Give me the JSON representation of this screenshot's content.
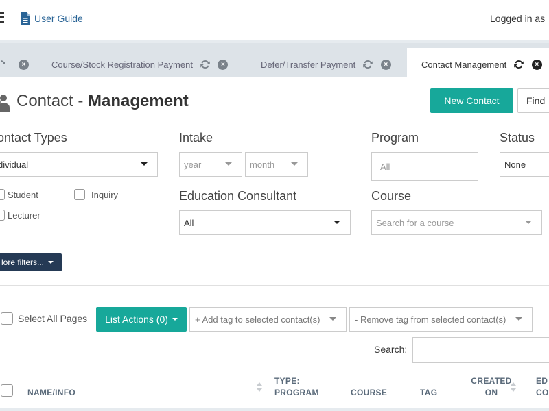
{
  "topbar": {
    "guide_label": "User Guide",
    "logged_in_text": "Logged in as"
  },
  "tabs": [
    {
      "label": "Course/Stock Registration Payment",
      "active": false
    },
    {
      "label": "Defer/Transfer Payment",
      "active": false
    },
    {
      "label": "Contact Management",
      "active": true
    }
  ],
  "tab_close_glyph": "×",
  "header": {
    "title_prefix": "Contact - ",
    "title_bold": "Management",
    "new_contact_label": "New Contact",
    "find_label": "Find"
  },
  "filters": {
    "contact_types": {
      "label": "ontact Types",
      "value": "dividual",
      "checkboxes": [
        "Student",
        "Inquiry",
        "Lecturer"
      ]
    },
    "intake": {
      "label": "Intake",
      "year_placeholder": "year",
      "month_placeholder": "month"
    },
    "program": {
      "label": "Program",
      "value": "All"
    },
    "status": {
      "label": "Status",
      "value": "None"
    },
    "education_consultant": {
      "label": "Education Consultant",
      "value": "All"
    },
    "course": {
      "label": "Course",
      "placeholder": "Search for a course"
    },
    "more_filters_label": "lore filters..."
  },
  "list_actions": {
    "select_all_label": "Select All Pages",
    "list_actions_label": "List Actions (0)",
    "add_tag_placeholder": "+ Add tag to selected contact(s)",
    "remove_tag_placeholder": "- Remove tag from selected contact(s)",
    "search_label": "Search:"
  },
  "table": {
    "headers": {
      "name": "NAME/INFO",
      "type_line1": "TYPE:",
      "type_line2": "PROGRAM",
      "course": "COURSE",
      "tag": "TAG",
      "created_line1": "CREATED",
      "created_line2": "ON",
      "edit_line1": "ED",
      "edit_line2": "CO"
    }
  },
  "colors": {
    "primary": "#17a89a",
    "dark_button": "#253a55",
    "link": "#2a6496"
  }
}
